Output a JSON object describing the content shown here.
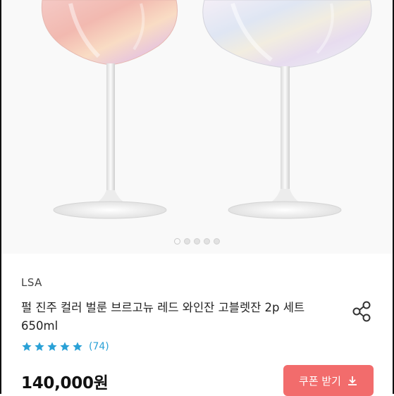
{
  "product": {
    "brand": "LSA",
    "title": "펄 진주 컬러 벌룬 브르고뉴 레드 와인잔 고블렛잔 2p 세트 650ml",
    "rating_value": 5,
    "review_count": "(74)",
    "price": "140,000원"
  },
  "gallery": {
    "image_count": 5,
    "active_index": 0
  },
  "actions": {
    "coupon_label": "쿠폰 받기",
    "coupon_icon": "download-icon",
    "share_icon": "share-icon"
  },
  "colors": {
    "star": "#2aa1d6",
    "coupon_bg": "#f26c6c",
    "review_count": "#2aa1d6"
  }
}
